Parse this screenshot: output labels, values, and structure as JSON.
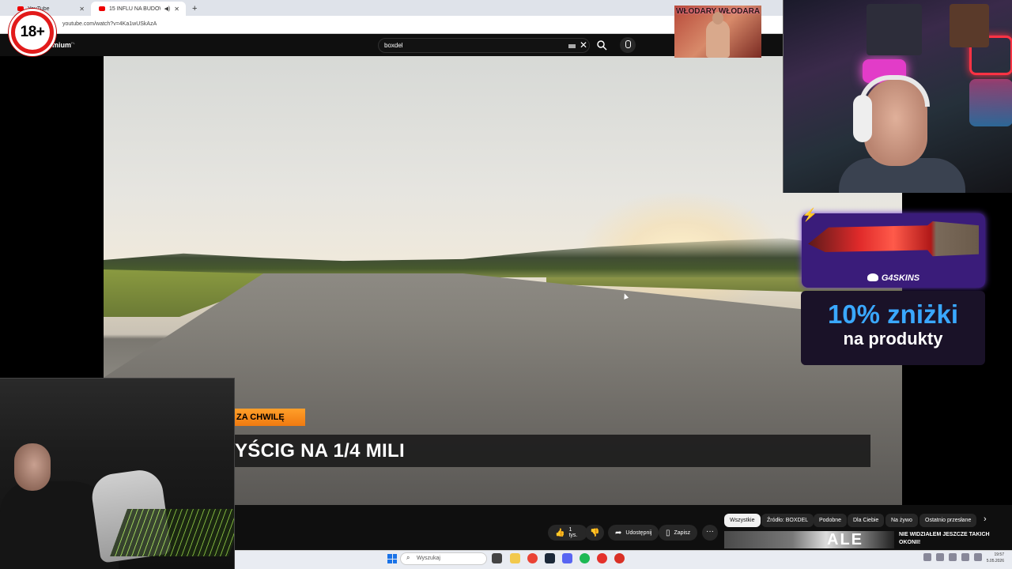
{
  "browser": {
    "tabs": [
      {
        "title": "YouTube"
      },
      {
        "title": "15 INFLU NA BUDOWIE: Le"
      }
    ],
    "url": "youtube.com/watch?v=4Ka1wUSkAzA"
  },
  "youtube": {
    "logo_text": "mium",
    "logo_region": "PL",
    "search_query": "boxdel"
  },
  "video": {
    "lower_tag": "ZA CHWILĘ",
    "lower_title": "YŚCIG NA 1/4 MILI"
  },
  "actions": {
    "like_count": "1 tys.",
    "share_label": "Udostępnij",
    "save_label": "Zapisz"
  },
  "chips": [
    "Wszystkie",
    "Źródło: BOXDEL",
    "Podobne",
    "Dla Ciebie",
    "Na żywo",
    "Ostatnio przesłane"
  ],
  "recommendation": {
    "thumb_text": "ALE",
    "title": "NIE WIDZIAŁEM JESZCZE TAKICH OKONII!"
  },
  "taskbar": {
    "search_placeholder": "Wyszukaj",
    "time": "19:57",
    "date": "5.05.2026"
  },
  "overlay": {
    "age_badge": "18+",
    "sticker_text": "WŁODARY WŁODARA",
    "ad_brand": "G4SKINS",
    "ad_offer_big": "10% zniżki",
    "ad_offer_small": "na produkty"
  },
  "colors": {
    "youtube_bg": "#0f0f0f",
    "accent_orange": "#f07a10",
    "age_red": "#e21b1b",
    "ad_blue": "#3aa8ff",
    "ad_purple": "#3a1c7a"
  }
}
